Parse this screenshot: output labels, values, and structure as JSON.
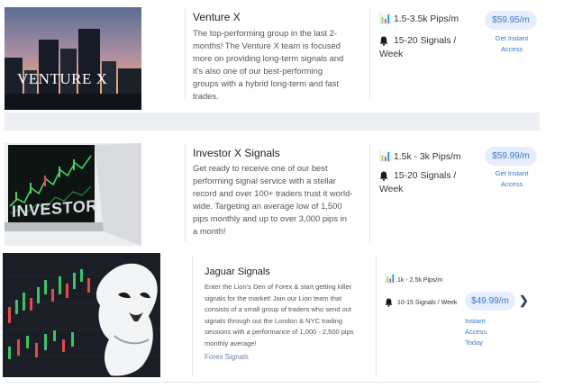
{
  "groups": [
    {
      "title": "Venture X",
      "image_text": "VENTURE X",
      "description": "The top-performing group in the last 2-months! The Venture X team is focused more on providing long-term signals and it's also one of our best-performing groups with a hybrid long-term and fast trades.",
      "pips": "1.5-3.5k Pips/m",
      "signals": "15-20 Signals / Week",
      "price": "$59.95/m",
      "access": "Get Instant Access"
    },
    {
      "title": "Investor X Signals",
      "image_text": "INVESTOR X",
      "description": "Get ready to receive one of our best performing signal service with a stellar record and over 100+ traders trust it world-wide. Targeting an average low of 1,500 pips monthly and up to over 3,000 pips in a month!",
      "pips": "1.5k - 3k Pips/m",
      "signals": "15-20 Signals / Week",
      "price": "$59.99/m",
      "access": "Get Instant Access"
    },
    {
      "title": "Jaguar Signals",
      "description": "Enter the Lion's Den of Forex & start getting killer signals for the market! Join our Lion team that consists of a small group of traders who send out signals through out the London & NYC trading sessions with a performance of 1,000 - 2,500 pips monthly average!",
      "link": "Forex Signals",
      "pips": "1k - 2.5k Pips/m",
      "signals": "10-15 Signals / Week",
      "price": "$49.99/m",
      "access": "Instant Access Today",
      "next_icon": "chevron-right-icon"
    }
  ]
}
